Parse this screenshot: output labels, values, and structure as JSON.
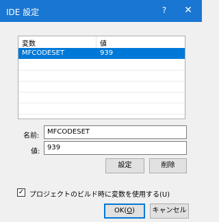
{
  "window": {
    "title": "IDE 設定",
    "help_glyph": "?",
    "close_glyph": "✕"
  },
  "list": {
    "columns": [
      "変数",
      "値"
    ],
    "rows": [
      {
        "name": "MFCODESET",
        "value": "939",
        "selected": true
      }
    ]
  },
  "form": {
    "name_label": "名前:",
    "name_value": "MFCODESET",
    "value_label": "値:",
    "value_value": "939"
  },
  "buttons": {
    "set": "設定",
    "delete": "削除",
    "ok_prefix": "OK(",
    "ok_key": "O",
    "ok_suffix": ")",
    "cancel": "キャンセル"
  },
  "checkbox": {
    "checked": true,
    "check_glyph": "✓",
    "label": "プロジェクトのビルド時に変数を使用する(U)"
  }
}
